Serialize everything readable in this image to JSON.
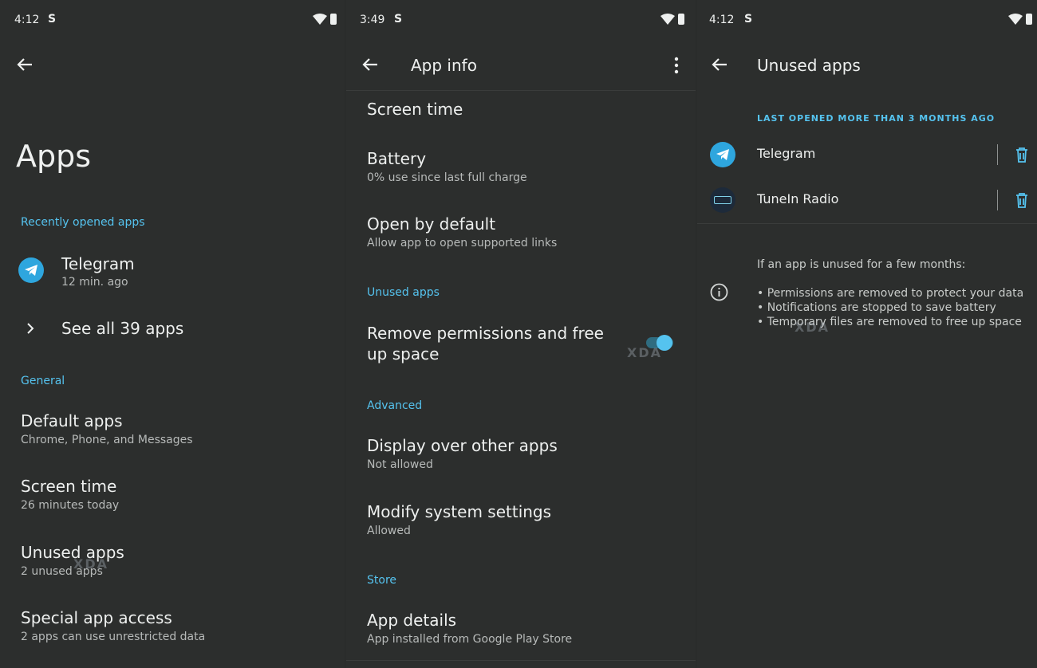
{
  "colors": {
    "accent": "#55c3ef",
    "background": "#2c2e2d",
    "text": "#eef0ef",
    "subtext": "#b7bab9"
  },
  "panel1": {
    "time": "4:12",
    "status_icon": "S",
    "title": "Apps",
    "recent_section": "Recently opened apps",
    "recent_app": {
      "name": "Telegram",
      "time": "12 min. ago",
      "icon": "telegram-icon"
    },
    "see_all": "See all 39 apps",
    "general_section": "General",
    "items": [
      {
        "title": "Default apps",
        "sub": "Chrome, Phone, and Messages"
      },
      {
        "title": "Screen time",
        "sub": "26 minutes today"
      },
      {
        "title": "Unused apps",
        "sub": "2 unused apps"
      },
      {
        "title": "Special app access",
        "sub": "2 apps can use unrestricted data"
      }
    ],
    "watermark": "XDA"
  },
  "panel2": {
    "time": "3:49",
    "status_icon": "S",
    "title": "App info",
    "screen_time": "Screen time",
    "battery": {
      "title": "Battery",
      "sub": "0% use since last full charge"
    },
    "open_default": {
      "title": "Open by default",
      "sub": "Allow app to open supported links"
    },
    "unused_section": "Unused apps",
    "remove_perm": {
      "title": "Remove permissions and free up space",
      "enabled": true
    },
    "advanced_section": "Advanced",
    "display_over": {
      "title": "Display over other apps",
      "sub": "Not allowed"
    },
    "modify_system": {
      "title": "Modify system settings",
      "sub": "Allowed"
    },
    "store_section": "Store",
    "app_details": {
      "title": "App details",
      "sub": "App installed from Google Play Store"
    },
    "watermark": "XDA"
  },
  "panel3": {
    "time": "4:12",
    "status_icon": "S",
    "title": "Unused apps",
    "section": "LAST OPENED MORE THAN 3 MONTHS AGO",
    "apps": [
      {
        "name": "Telegram",
        "icon": "telegram-icon"
      },
      {
        "name": "TuneIn Radio",
        "icon": "tunein-icon"
      }
    ],
    "info_heading": "If an app is unused for a few months:",
    "info_points": [
      "• Permissions are removed to protect your data",
      "• Notifications are stopped to save battery",
      "• Temporary files are removed to free up space"
    ],
    "watermark": "XDA"
  }
}
